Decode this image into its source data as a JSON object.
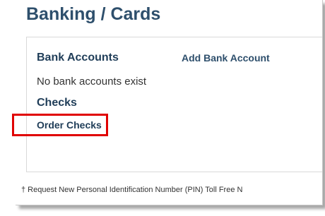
{
  "page": {
    "title": "Banking / Cards"
  },
  "bank_accounts": {
    "heading": "Bank Accounts",
    "add_link": "Add Bank Account",
    "empty_message": "No bank accounts exist"
  },
  "checks": {
    "heading": "Checks",
    "order_link": "Order Checks",
    "highlight_color": "#e00000"
  },
  "footnote": {
    "text": "† Request New Personal Identification Number (PIN) Toll Free N"
  }
}
